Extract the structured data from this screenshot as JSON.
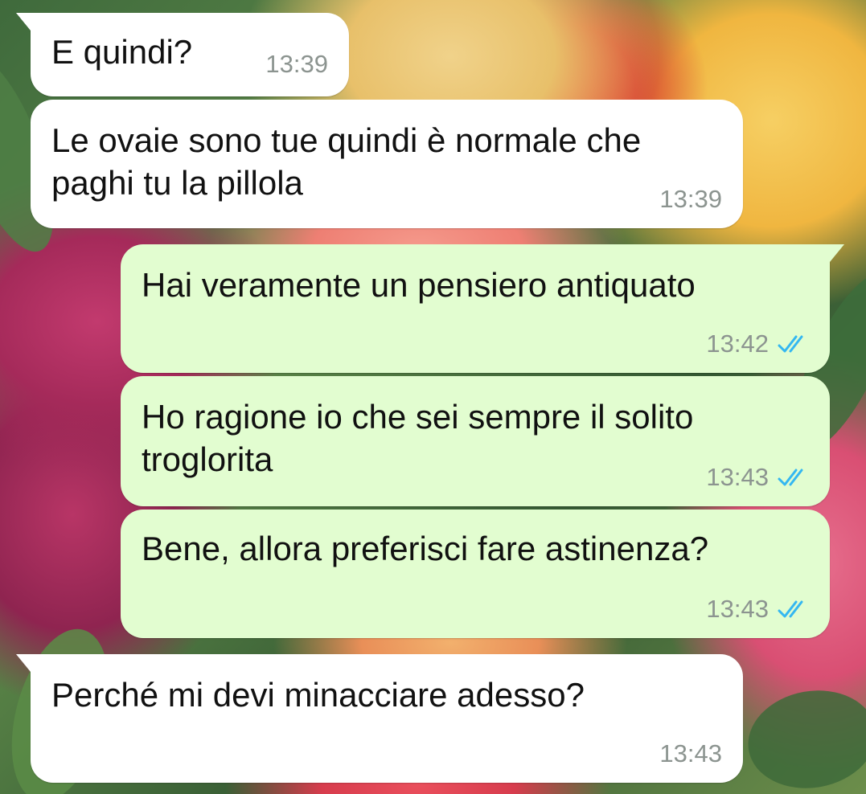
{
  "chat": {
    "messages": [
      {
        "text": "E quindi?",
        "time": "13:39",
        "direction": "incoming"
      },
      {
        "text": "Le ovaie sono tue quindi è normale che paghi tu la pillola",
        "time": "13:39",
        "direction": "incoming"
      },
      {
        "text": "Hai veramente un pensiero antiquato",
        "time": "13:42",
        "direction": "outgoing",
        "status_icon": "double-check-read-icon"
      },
      {
        "text": "Ho ragione io che sei sempre il solito troglorita",
        "time": "13:43",
        "direction": "outgoing",
        "status_icon": "double-check-read-icon"
      },
      {
        "text": "Bene, allora preferisci fare astinenza?",
        "time": "13:43",
        "direction": "outgoing",
        "status_icon": "double-check-read-icon"
      },
      {
        "text": "Perché mi devi minacciare adesso?",
        "time": "13:43",
        "direction": "incoming"
      }
    ]
  },
  "colors": {
    "incoming_bubble": "#ffffff",
    "outgoing_bubble": "#e2fdd0",
    "timestamp": "#8c9490",
    "read_ticks": "#34b7f1"
  }
}
